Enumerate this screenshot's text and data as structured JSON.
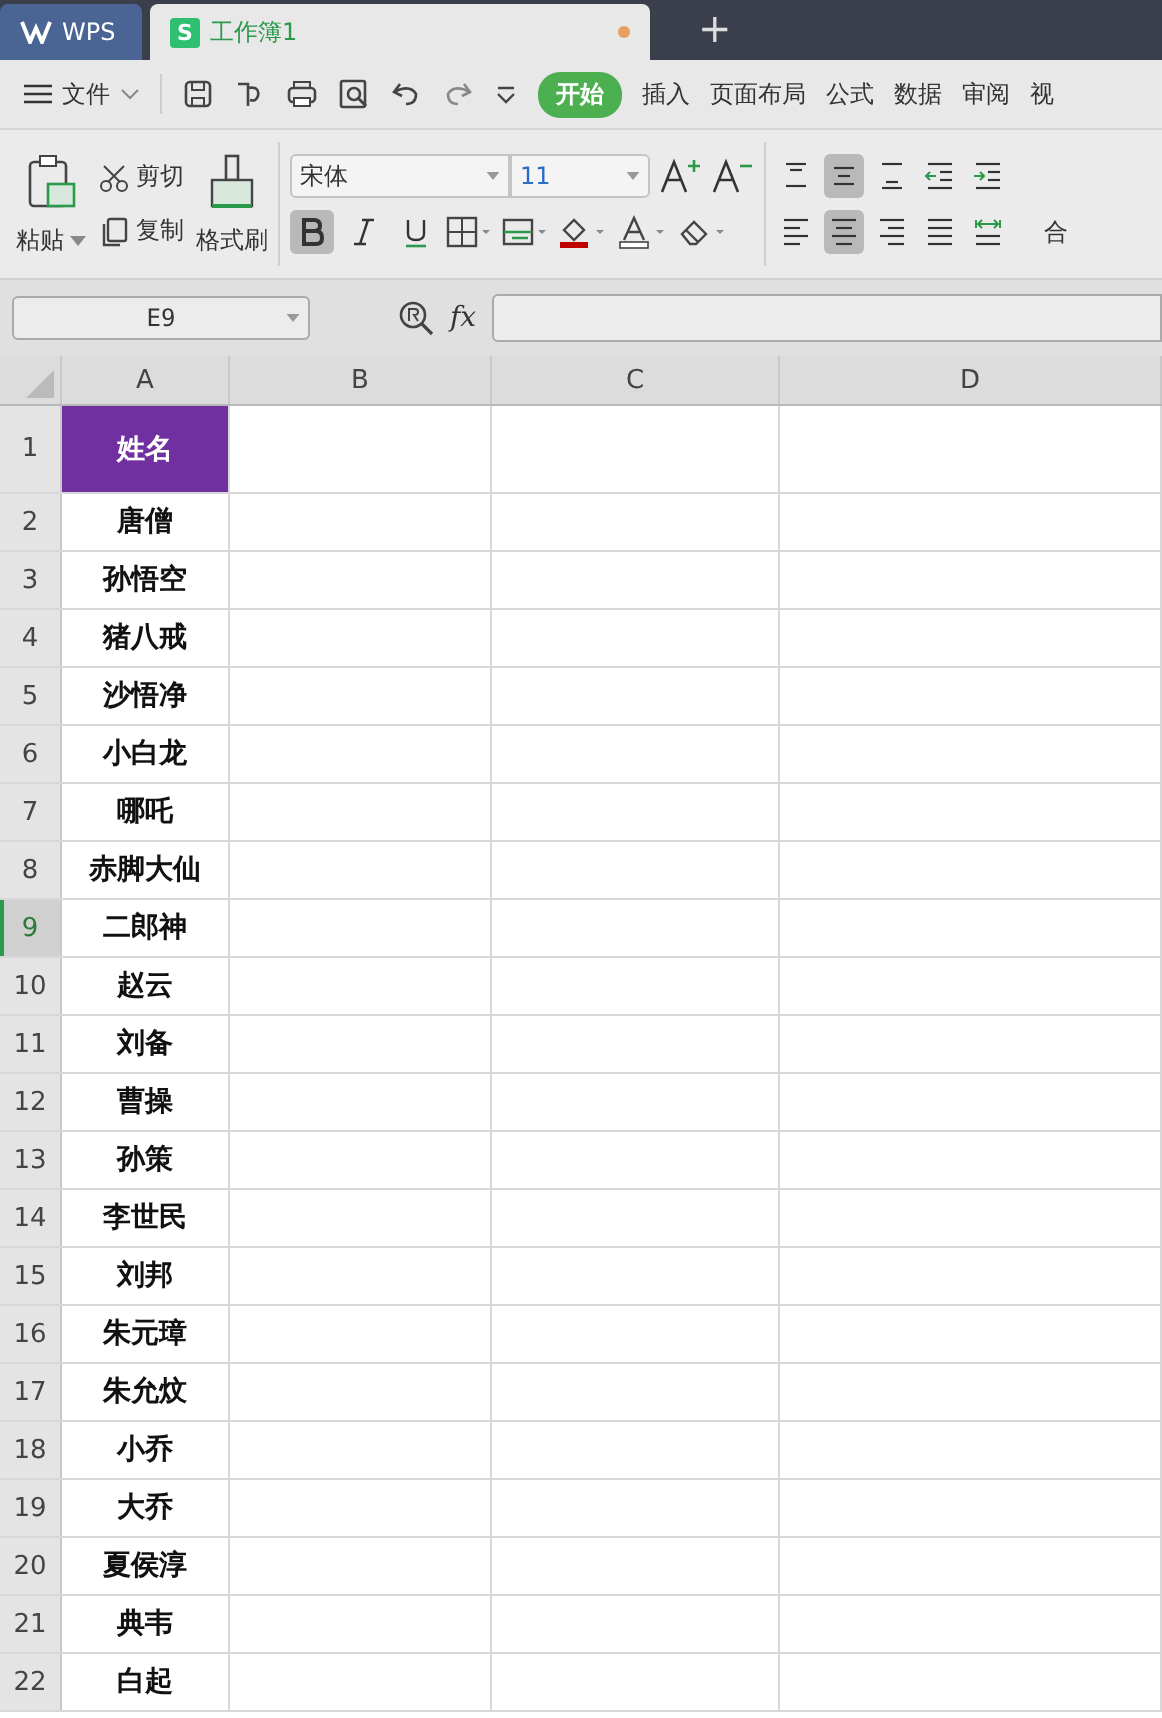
{
  "tabs": [
    {
      "kind": "home",
      "label": "WPS",
      "selected": false,
      "unsaved": false
    },
    {
      "kind": "sheet",
      "icon": "S",
      "label": "工作簿1",
      "selected": true,
      "unsaved": true
    }
  ],
  "new_tab": "+",
  "menu": {
    "file": "文件",
    "ribbon_tabs": [
      {
        "label": "开始",
        "selected": true
      },
      {
        "label": "插入",
        "selected": false
      },
      {
        "label": "页面布局",
        "selected": false
      },
      {
        "label": "公式",
        "selected": false
      },
      {
        "label": "数据",
        "selected": false
      },
      {
        "label": "审阅",
        "selected": false
      },
      {
        "label": "视",
        "selected": false
      }
    ]
  },
  "ribbon": {
    "paste": "粘贴",
    "cut": "剪切",
    "copy": "复制",
    "format_painter": "格式刷",
    "font_name": "宋体",
    "font_size": "11",
    "format_buttons": [
      {
        "kind": "bold",
        "on": true
      },
      {
        "kind": "italic",
        "on": false
      },
      {
        "kind": "underline",
        "on": false
      }
    ],
    "align_top": [
      {
        "kind": "top",
        "on": false
      },
      {
        "kind": "middle",
        "on": true
      },
      {
        "kind": "bottom",
        "on": false
      },
      {
        "kind": "outdent",
        "on": false
      },
      {
        "kind": "indent",
        "on": false
      }
    ],
    "align_bottom": [
      {
        "kind": "left",
        "on": false
      },
      {
        "kind": "center",
        "on": true
      },
      {
        "kind": "right",
        "on": false
      },
      {
        "kind": "justify",
        "on": false
      },
      {
        "kind": "distribute",
        "on": false
      }
    ],
    "merge": "合"
  },
  "formula_bar": {
    "cell_ref": "E9",
    "fx": "fx"
  },
  "sheet": {
    "columns": [
      "A",
      "B",
      "C",
      "D"
    ],
    "rows": [
      {
        "number": "1",
        "kind": "header",
        "name": "姓名",
        "selected": false
      },
      {
        "number": "2",
        "kind": "data",
        "name": "唐僧",
        "selected": false
      },
      {
        "number": "3",
        "kind": "data",
        "name": "孙悟空",
        "selected": false
      },
      {
        "number": "4",
        "kind": "data",
        "name": "猪八戒",
        "selected": false
      },
      {
        "number": "5",
        "kind": "data",
        "name": "沙悟净",
        "selected": false
      },
      {
        "number": "6",
        "kind": "data",
        "name": "小白龙",
        "selected": false
      },
      {
        "number": "7",
        "kind": "data",
        "name": "哪吒",
        "selected": false
      },
      {
        "number": "8",
        "kind": "data",
        "name": "赤脚大仙",
        "selected": false
      },
      {
        "number": "9",
        "kind": "data",
        "name": "二郎神",
        "selected": true
      },
      {
        "number": "10",
        "kind": "data",
        "name": "赵云",
        "selected": false
      },
      {
        "number": "11",
        "kind": "data",
        "name": "刘备",
        "selected": false
      },
      {
        "number": "12",
        "kind": "data",
        "name": "曹操",
        "selected": false
      },
      {
        "number": "13",
        "kind": "data",
        "name": "孙策",
        "selected": false
      },
      {
        "number": "14",
        "kind": "data",
        "name": "李世民",
        "selected": false
      },
      {
        "number": "15",
        "kind": "data",
        "name": "刘邦",
        "selected": false
      },
      {
        "number": "16",
        "kind": "data",
        "name": "朱元璋",
        "selected": false
      },
      {
        "number": "17",
        "kind": "data",
        "name": "朱允炆",
        "selected": false
      },
      {
        "number": "18",
        "kind": "data",
        "name": "小乔",
        "selected": false
      },
      {
        "number": "19",
        "kind": "data",
        "name": "大乔",
        "selected": false
      },
      {
        "number": "20",
        "kind": "data",
        "name": "夏侯淳",
        "selected": false
      },
      {
        "number": "21",
        "kind": "data",
        "name": "典韦",
        "selected": false
      },
      {
        "number": "22",
        "kind": "data",
        "name": "白起",
        "selected": false
      }
    ]
  }
}
